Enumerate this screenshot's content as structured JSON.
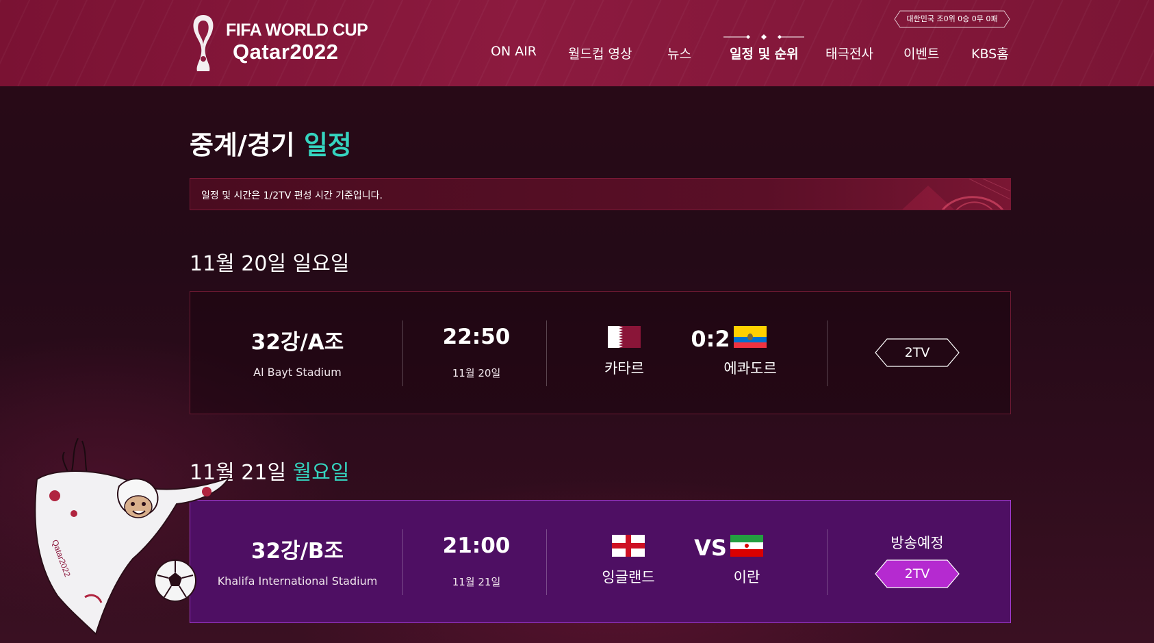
{
  "header": {
    "logo_line1": "FIFA WORLD CUP",
    "logo_line2": "Qatar2022",
    "record_pill": "대한민국 조0위 0승 0무 0패",
    "nav": [
      {
        "label": "ON AIR"
      },
      {
        "label": "월드컵 영상"
      },
      {
        "label": "뉴스"
      },
      {
        "label": "일정 및 순위",
        "active": true
      },
      {
        "label": "태극전사"
      },
      {
        "label": "이벤트"
      },
      {
        "label": "KBS홈"
      }
    ]
  },
  "page": {
    "title_main": "중계/경기 ",
    "title_accent": "일정",
    "notice": "일정 및 시간은 1/2TV 편성 시간 기준입니다."
  },
  "days": [
    {
      "date": "11월 20일 ",
      "weekday": "일요일",
      "match": {
        "round": "32강/A조",
        "stadium": "Al Bayt Stadium",
        "time": "22:50",
        "date": "11월 20일",
        "home_team": "카타르",
        "home_flag": "qatar-flag",
        "score": "0:2",
        "away_team": "에콰도르",
        "away_flag": "ecuador-flag",
        "channel": "2TV",
        "status": ""
      }
    },
    {
      "date": "11월 21일 ",
      "weekday": "월요일",
      "match": {
        "round": "32강/B조",
        "stadium": "Khalifa International Stadium",
        "time": "21:00",
        "date": "11월 21일",
        "home_team": "잉글랜드",
        "home_flag": "england-flag",
        "score": "VS",
        "away_team": "이란",
        "away_flag": "iran-flag",
        "channel": "2TV",
        "status": "방송예정"
      }
    }
  ],
  "colors": {
    "header_bg": "#8c1a3f",
    "accent_teal": "#35d4bf",
    "upcoming_card": "#4e0f63",
    "channel_active": "#b52ad0"
  }
}
